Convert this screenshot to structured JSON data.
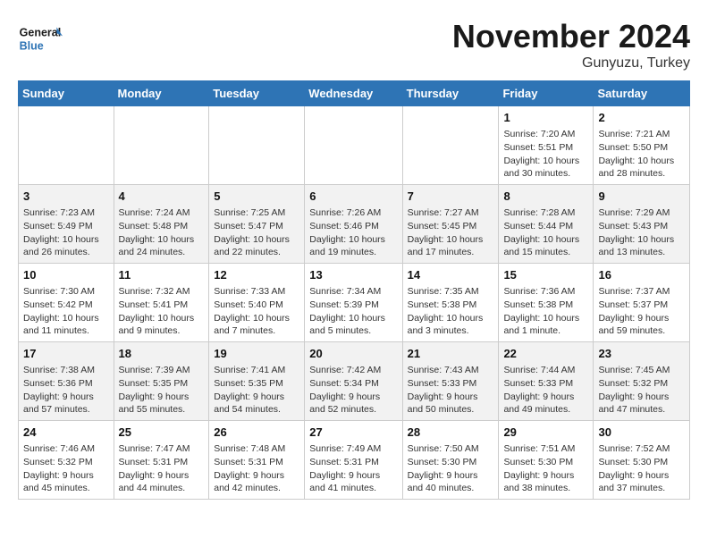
{
  "header": {
    "logo_general": "General",
    "logo_blue": "Blue",
    "month_title": "November 2024",
    "location": "Gunyuzu, Turkey"
  },
  "days_of_week": [
    "Sunday",
    "Monday",
    "Tuesday",
    "Wednesday",
    "Thursday",
    "Friday",
    "Saturday"
  ],
  "weeks": [
    [
      {
        "day": "",
        "sunrise": "",
        "sunset": "",
        "daylight": ""
      },
      {
        "day": "",
        "sunrise": "",
        "sunset": "",
        "daylight": ""
      },
      {
        "day": "",
        "sunrise": "",
        "sunset": "",
        "daylight": ""
      },
      {
        "day": "",
        "sunrise": "",
        "sunset": "",
        "daylight": ""
      },
      {
        "day": "",
        "sunrise": "",
        "sunset": "",
        "daylight": ""
      },
      {
        "day": "1",
        "sunrise": "Sunrise: 7:20 AM",
        "sunset": "Sunset: 5:51 PM",
        "daylight": "Daylight: 10 hours and 30 minutes."
      },
      {
        "day": "2",
        "sunrise": "Sunrise: 7:21 AM",
        "sunset": "Sunset: 5:50 PM",
        "daylight": "Daylight: 10 hours and 28 minutes."
      }
    ],
    [
      {
        "day": "3",
        "sunrise": "Sunrise: 7:23 AM",
        "sunset": "Sunset: 5:49 PM",
        "daylight": "Daylight: 10 hours and 26 minutes."
      },
      {
        "day": "4",
        "sunrise": "Sunrise: 7:24 AM",
        "sunset": "Sunset: 5:48 PM",
        "daylight": "Daylight: 10 hours and 24 minutes."
      },
      {
        "day": "5",
        "sunrise": "Sunrise: 7:25 AM",
        "sunset": "Sunset: 5:47 PM",
        "daylight": "Daylight: 10 hours and 22 minutes."
      },
      {
        "day": "6",
        "sunrise": "Sunrise: 7:26 AM",
        "sunset": "Sunset: 5:46 PM",
        "daylight": "Daylight: 10 hours and 19 minutes."
      },
      {
        "day": "7",
        "sunrise": "Sunrise: 7:27 AM",
        "sunset": "Sunset: 5:45 PM",
        "daylight": "Daylight: 10 hours and 17 minutes."
      },
      {
        "day": "8",
        "sunrise": "Sunrise: 7:28 AM",
        "sunset": "Sunset: 5:44 PM",
        "daylight": "Daylight: 10 hours and 15 minutes."
      },
      {
        "day": "9",
        "sunrise": "Sunrise: 7:29 AM",
        "sunset": "Sunset: 5:43 PM",
        "daylight": "Daylight: 10 hours and 13 minutes."
      }
    ],
    [
      {
        "day": "10",
        "sunrise": "Sunrise: 7:30 AM",
        "sunset": "Sunset: 5:42 PM",
        "daylight": "Daylight: 10 hours and 11 minutes."
      },
      {
        "day": "11",
        "sunrise": "Sunrise: 7:32 AM",
        "sunset": "Sunset: 5:41 PM",
        "daylight": "Daylight: 10 hours and 9 minutes."
      },
      {
        "day": "12",
        "sunrise": "Sunrise: 7:33 AM",
        "sunset": "Sunset: 5:40 PM",
        "daylight": "Daylight: 10 hours and 7 minutes."
      },
      {
        "day": "13",
        "sunrise": "Sunrise: 7:34 AM",
        "sunset": "Sunset: 5:39 PM",
        "daylight": "Daylight: 10 hours and 5 minutes."
      },
      {
        "day": "14",
        "sunrise": "Sunrise: 7:35 AM",
        "sunset": "Sunset: 5:38 PM",
        "daylight": "Daylight: 10 hours and 3 minutes."
      },
      {
        "day": "15",
        "sunrise": "Sunrise: 7:36 AM",
        "sunset": "Sunset: 5:38 PM",
        "daylight": "Daylight: 10 hours and 1 minute."
      },
      {
        "day": "16",
        "sunrise": "Sunrise: 7:37 AM",
        "sunset": "Sunset: 5:37 PM",
        "daylight": "Daylight: 9 hours and 59 minutes."
      }
    ],
    [
      {
        "day": "17",
        "sunrise": "Sunrise: 7:38 AM",
        "sunset": "Sunset: 5:36 PM",
        "daylight": "Daylight: 9 hours and 57 minutes."
      },
      {
        "day": "18",
        "sunrise": "Sunrise: 7:39 AM",
        "sunset": "Sunset: 5:35 PM",
        "daylight": "Daylight: 9 hours and 55 minutes."
      },
      {
        "day": "19",
        "sunrise": "Sunrise: 7:41 AM",
        "sunset": "Sunset: 5:35 PM",
        "daylight": "Daylight: 9 hours and 54 minutes."
      },
      {
        "day": "20",
        "sunrise": "Sunrise: 7:42 AM",
        "sunset": "Sunset: 5:34 PM",
        "daylight": "Daylight: 9 hours and 52 minutes."
      },
      {
        "day": "21",
        "sunrise": "Sunrise: 7:43 AM",
        "sunset": "Sunset: 5:33 PM",
        "daylight": "Daylight: 9 hours and 50 minutes."
      },
      {
        "day": "22",
        "sunrise": "Sunrise: 7:44 AM",
        "sunset": "Sunset: 5:33 PM",
        "daylight": "Daylight: 9 hours and 49 minutes."
      },
      {
        "day": "23",
        "sunrise": "Sunrise: 7:45 AM",
        "sunset": "Sunset: 5:32 PM",
        "daylight": "Daylight: 9 hours and 47 minutes."
      }
    ],
    [
      {
        "day": "24",
        "sunrise": "Sunrise: 7:46 AM",
        "sunset": "Sunset: 5:32 PM",
        "daylight": "Daylight: 9 hours and 45 minutes."
      },
      {
        "day": "25",
        "sunrise": "Sunrise: 7:47 AM",
        "sunset": "Sunset: 5:31 PM",
        "daylight": "Daylight: 9 hours and 44 minutes."
      },
      {
        "day": "26",
        "sunrise": "Sunrise: 7:48 AM",
        "sunset": "Sunset: 5:31 PM",
        "daylight": "Daylight: 9 hours and 42 minutes."
      },
      {
        "day": "27",
        "sunrise": "Sunrise: 7:49 AM",
        "sunset": "Sunset: 5:31 PM",
        "daylight": "Daylight: 9 hours and 41 minutes."
      },
      {
        "day": "28",
        "sunrise": "Sunrise: 7:50 AM",
        "sunset": "Sunset: 5:30 PM",
        "daylight": "Daylight: 9 hours and 40 minutes."
      },
      {
        "day": "29",
        "sunrise": "Sunrise: 7:51 AM",
        "sunset": "Sunset: 5:30 PM",
        "daylight": "Daylight: 9 hours and 38 minutes."
      },
      {
        "day": "30",
        "sunrise": "Sunrise: 7:52 AM",
        "sunset": "Sunset: 5:30 PM",
        "daylight": "Daylight: 9 hours and 37 minutes."
      }
    ]
  ]
}
